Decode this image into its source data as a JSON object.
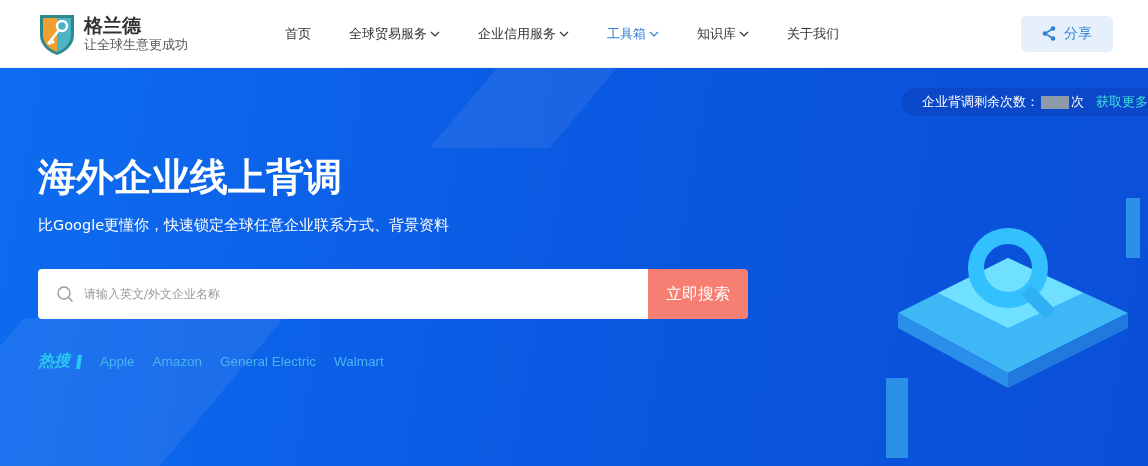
{
  "brand": {
    "name": "格兰德",
    "slogan": "让全球生意更成功"
  },
  "nav": [
    {
      "label": "首页",
      "dropdown": false,
      "selected": false
    },
    {
      "label": "全球贸易服务",
      "dropdown": true,
      "selected": false
    },
    {
      "label": "企业信用服务",
      "dropdown": true,
      "selected": false
    },
    {
      "label": "工具箱",
      "dropdown": true,
      "selected": true
    },
    {
      "label": "知识库",
      "dropdown": true,
      "selected": false
    },
    {
      "label": "关于我们",
      "dropdown": false,
      "selected": false
    }
  ],
  "share_button": "分享",
  "quota": {
    "label": "企业背调剩余次数：",
    "unit": "次",
    "link": "获取更多"
  },
  "hero": {
    "title": "海外企业线上背调",
    "subtitle": "比Google更懂你，快速锁定全球任意企业联系方式、背景资料"
  },
  "search": {
    "placeholder": "请输入英文/外文企业名称",
    "button": "立即搜索"
  },
  "hot_search": {
    "label": "热搜",
    "items": [
      "Apple",
      "Amazon",
      "General Electric",
      "Walmart"
    ]
  }
}
